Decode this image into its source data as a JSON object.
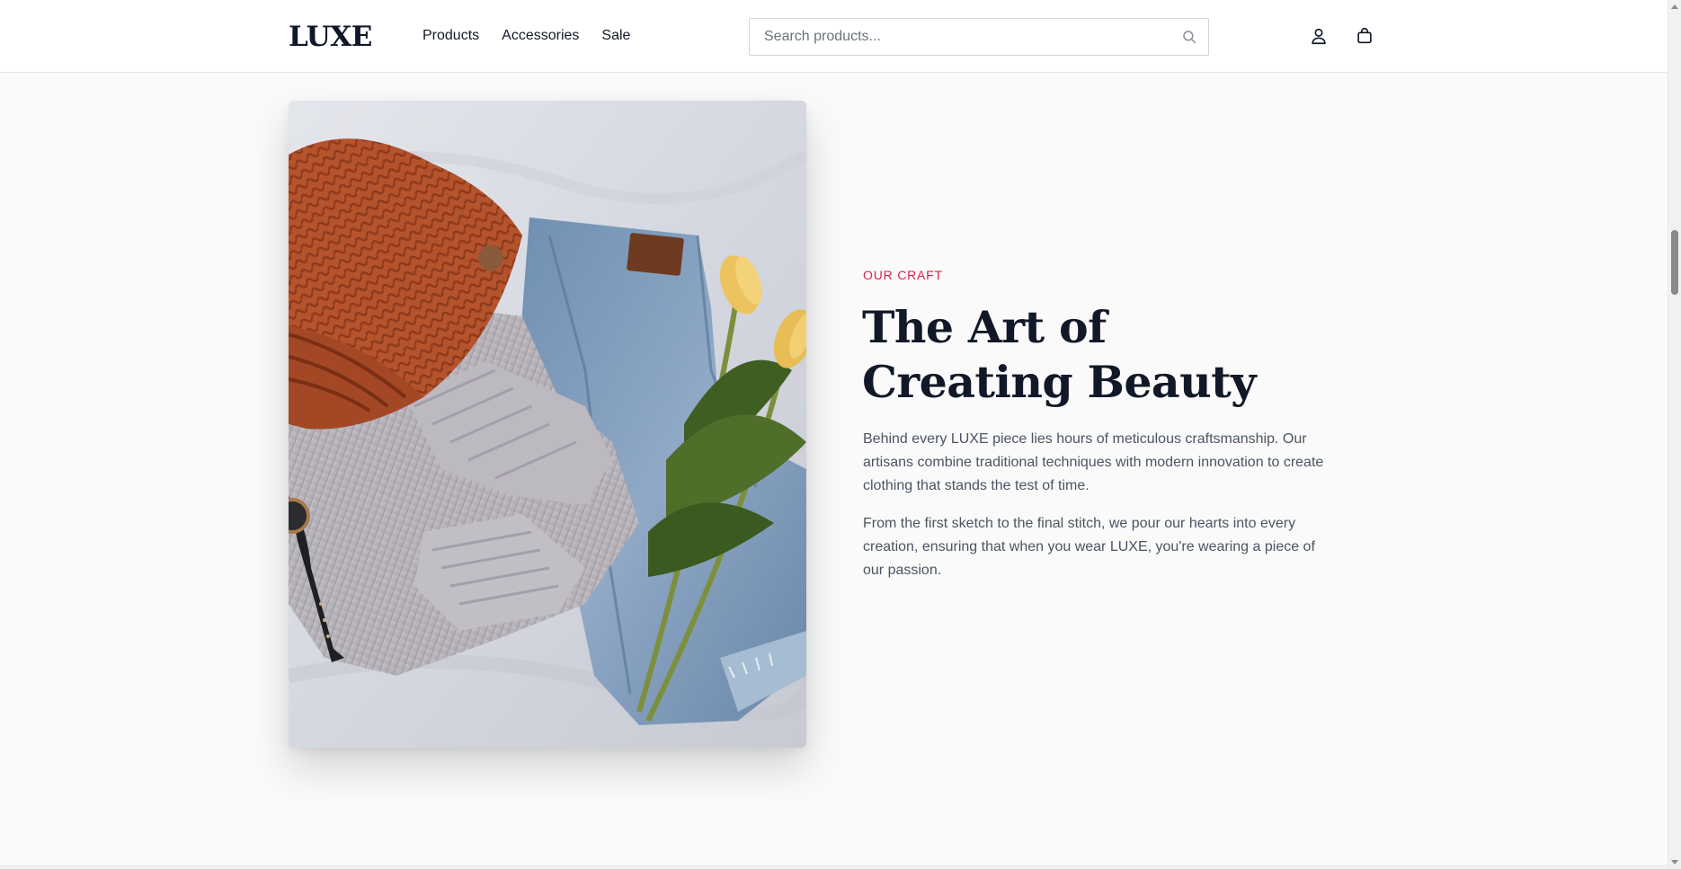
{
  "header": {
    "logo": "LUXE",
    "nav": [
      {
        "label": "Products"
      },
      {
        "label": "Accessories"
      },
      {
        "label": "Sale"
      }
    ],
    "search": {
      "placeholder": "Search products...",
      "value": "",
      "icon": "search-icon"
    },
    "account_icon": "user-icon",
    "cart_icon": "shopping-bag-icon"
  },
  "craft_section": {
    "eyebrow": "OUR CRAFT",
    "title": "The Art of Creating Beauty",
    "paragraphs": [
      "Behind every LUXE piece lies hours of meticulous craftsmanship. Our artisans combine traditional techniques with modern innovation to create clothing that stands the test of time.",
      "From the first sketch to the final stitch, we pour our hearts into every creation, ensuring that when you wear LUXE, you're wearing a piece of our passion."
    ],
    "image": "flat-lay-knit-beanie-sweater-jeans-tulips"
  },
  "colors": {
    "accent": "#e11d48",
    "heading": "#111827",
    "body": "#4b5563",
    "background": "#fafafa"
  }
}
